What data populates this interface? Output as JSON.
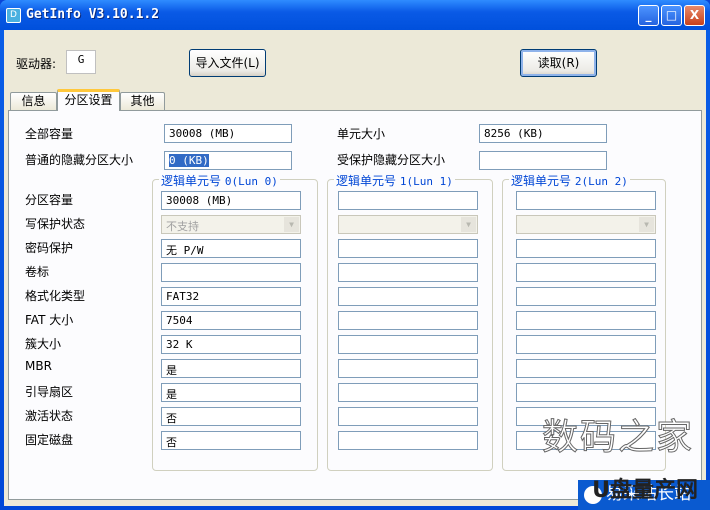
{
  "window": {
    "title": "GetInfo V3.10.1.2",
    "minimize": "_",
    "maximize": "□",
    "close": "X"
  },
  "toolbar": {
    "drive_label": "驱动器:",
    "drive_value": "G",
    "import_button": "导入文件(L)",
    "read_button": "读取(R)"
  },
  "tabs": [
    {
      "label": "信息"
    },
    {
      "label": "分区设置",
      "selected": true
    },
    {
      "label": "其他"
    }
  ],
  "summary": {
    "total_label": "全部容量",
    "total_value": "30008 (MB)",
    "unit_label": "单元大小",
    "unit_value": "8256 (KB)",
    "hidden_label": "普通的隐藏分区大小",
    "hidden_value": "0 (KB)",
    "protected_label": "受保护隐藏分区大小",
    "protected_value": ""
  },
  "row_labels": [
    "分区容量",
    "写保护状态",
    "密码保护",
    "卷标",
    "格式化类型",
    "FAT 大小",
    "簇大小",
    "MBR",
    "引导扇区",
    "激活状态",
    "固定磁盘"
  ],
  "luns": [
    {
      "title": "逻辑单元号",
      "suffix": "0(Lun 0)",
      "values": [
        "30008 (MB)",
        "不支持",
        "无 P/W",
        "",
        "FAT32",
        "7504",
        "32 K",
        "是",
        "是",
        "否",
        "否"
      ]
    },
    {
      "title": "逻辑单元号",
      "suffix": "1(Lun 1)",
      "values": [
        "",
        "",
        "",
        "",
        "",
        "",
        "",
        "",
        "",
        "",
        ""
      ]
    },
    {
      "title": "逻辑单元号",
      "suffix": "2(Lun 2)",
      "values": [
        "",
        "",
        "",
        "",
        "",
        "",
        "",
        "",
        "",
        "",
        ""
      ]
    }
  ],
  "watermark": {
    "line1": "数码之家",
    "line2": "U盘量产网",
    "line3": "易采站长站"
  }
}
